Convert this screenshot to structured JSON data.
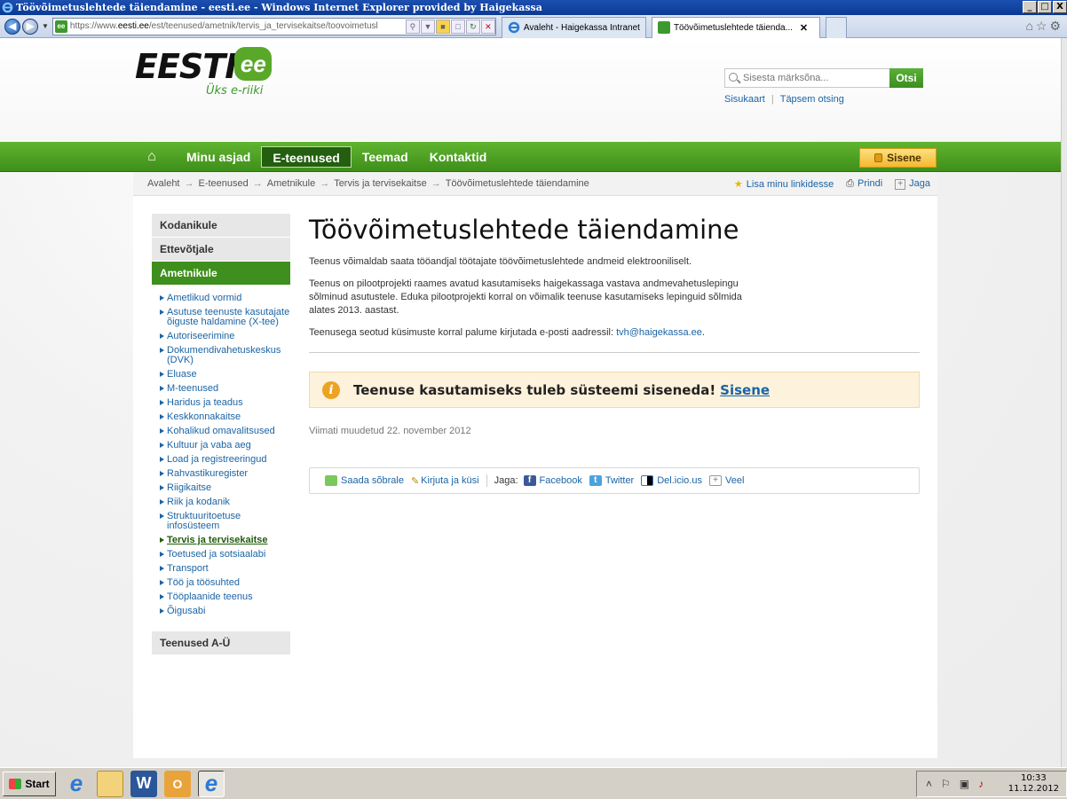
{
  "window": {
    "title": "Töövõimetuslehtede täiendamine - eesti.ee - Windows Internet Explorer provided by Haigekassa",
    "controls": [
      "_",
      "□",
      "X"
    ]
  },
  "browser": {
    "address_prefix": "https://www.",
    "address_domain": "eesti.ee",
    "address_path": "/est/teenused/ametnik/tervis_ja_tervisekaitse/toovoimetusl",
    "tabs": [
      {
        "label": "Avaleht - Haigekassa Intranet",
        "active": false
      },
      {
        "label": "Töövõimetuslehtede täienda...",
        "active": true,
        "close": "✕"
      }
    ]
  },
  "header": {
    "logo_word": "EESTI",
    "logo_badge": "ee",
    "logo_tagline": "Üks e-riiki",
    "search_placeholder": "Sisesta märksõna...",
    "search_button": "Otsi",
    "link_sitemap": "Sisukaart",
    "link_advanced": "Täpsem otsing"
  },
  "menu": {
    "home_icon": "⌂",
    "items": [
      "Minu asjad",
      "E-teenused",
      "Teemad",
      "Kontaktid"
    ],
    "active_index": 1,
    "login_button": "Sisene"
  },
  "breadcrumb": {
    "items": [
      "Avaleht",
      "E-teenused",
      "Ametnikule",
      "Tervis ja tervisekaitse",
      "Töövõimetuslehtede täiendamine"
    ],
    "separator": "→",
    "actions": {
      "favorite": "Lisa minu linkidesse",
      "print": "Prindi",
      "share": "Jaga"
    }
  },
  "sidebar": {
    "sections": [
      "Kodanikule",
      "Ettevõtjale",
      "Ametnikule"
    ],
    "active_section": "Ametnikule",
    "items": [
      "Ametlikud vormid",
      "Asutuse teenuste kasutajate õiguste haldamine (X-tee)",
      "Autoriseerimine",
      "Dokumendivahetuskeskus (DVK)",
      "Eluase",
      "M-teenused",
      "Haridus ja teadus",
      "Keskkonnakaitse",
      "Kohalikud omavalitsused",
      "Kultuur ja vaba aeg",
      "Load ja registreeringud",
      "Rahvastikuregister",
      "Riigikaitse",
      "Riik ja kodanik",
      "Struktuuritoetuse infosüsteem",
      "Tervis ja tervisekaitse",
      "Toetused ja sotsiaalabi",
      "Transport",
      "Töö ja töösuhted",
      "Tööplaanide teenus",
      "Õigusabi"
    ],
    "current_item": "Tervis ja tervisekaitse",
    "footer_section": "Teenused A-Ü"
  },
  "main": {
    "title": "Töövõimetuslehtede täiendamine",
    "p1": "Teenus võimaldab saata tööandjal töötajate töövõimetuslehtede andmeid elektrooniliselt.",
    "p2": "Teenus on pilootprojekti raames avatud kasutamiseks haigekassaga vastava andmevahetuslepingu sõlminud asutustele. Eduka pilootprojekti korral on võimalik teenuse kasutamiseks lepinguid sõlmida alates 2013. aastast.",
    "p3_text": "Teenusega seotud küsimuste korral palume kirjutada e-posti aadressil: ",
    "p3_email": "tvh@haigekassa.ee",
    "p3_end": ".",
    "notice_text": "Teenuse kasutamiseks tuleb süsteemi siseneda!",
    "notice_link": "Sisene",
    "modified": "Viimati muudetud 22. november 2012",
    "share": {
      "send_friend": "Saada sõbrale",
      "write_ask": "Kirjuta ja küsi",
      "share_label": "Jaga:",
      "facebook": "Facebook",
      "twitter": "Twitter",
      "delicious": "Del.icio.us",
      "more": "Veel"
    }
  },
  "taskbar": {
    "start": "Start",
    "time": "10:33",
    "date": "11.12.2012"
  },
  "colors": {
    "brand_green": "#3f8f1a",
    "link_blue": "#1b64a4",
    "notice_bg": "#fdf2dc"
  }
}
